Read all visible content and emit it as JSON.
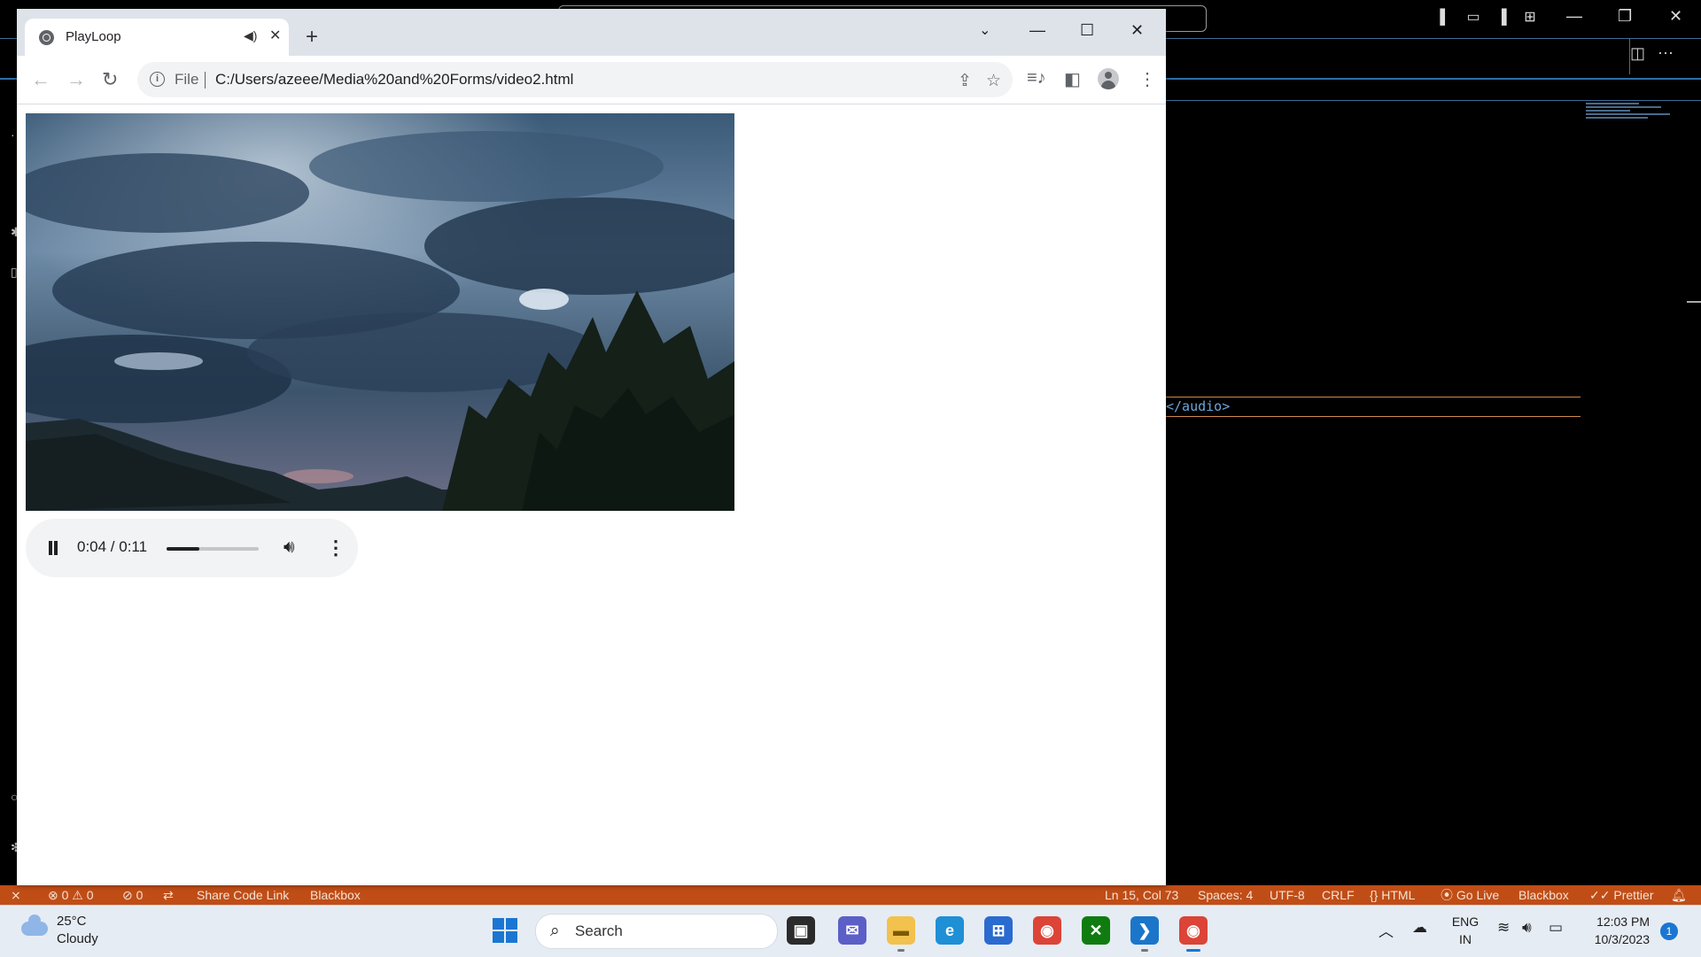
{
  "browser": {
    "tab_title": "PlayLoop",
    "address_scheme": "File",
    "address_url": "C:/Users/azeee/Media%20and%20Forms/video2.html"
  },
  "player": {
    "current_time": "0:04",
    "duration": "0:11",
    "time_display": "0:04 / 0:11",
    "progress_fraction": 0.36
  },
  "editor": {
    "code_line": "</audio>"
  },
  "statusbar": {
    "problems_errors": "0",
    "problems_warnings": "0",
    "ports": "0",
    "share_code": "Share Code Link",
    "blackbox": "Blackbox",
    "cursor": "Ln 15, Col 73",
    "spaces": "Spaces: 4",
    "encoding": "UTF-8",
    "eol": "CRLF",
    "language": "HTML",
    "go_live": "Go Live",
    "blackbox2": "Blackbox",
    "prettier": "Prettier"
  },
  "taskbar": {
    "temperature": "25°C",
    "condition": "Cloudy",
    "search_label": "Search",
    "lang_top": "ENG",
    "lang_bottom": "IN",
    "time": "12:03 PM",
    "date": "10/3/2023",
    "notification_count": "1"
  },
  "colors": {
    "statusbar": "#c14d16",
    "taskbar": "#e6ecf4",
    "chrome_tabstrip": "#dee3ea",
    "accent": "#1a76d2"
  }
}
